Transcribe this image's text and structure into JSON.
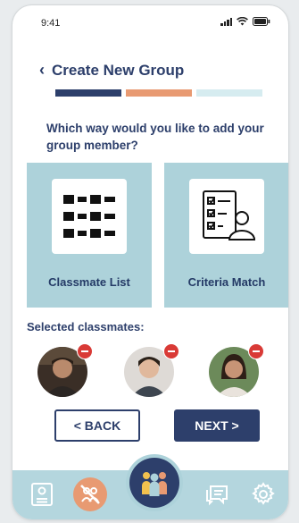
{
  "status": {
    "time": "9:41"
  },
  "header": {
    "back_icon": "chevron-left-icon",
    "title": "Create New Group"
  },
  "progress": {
    "steps": [
      "#2d3f6b",
      "#e89a72",
      "#d6ecf0"
    ]
  },
  "question": "Which way would you like to add your group member?",
  "options": [
    {
      "label": "Classmate List",
      "icon": "grid-list-icon"
    },
    {
      "label": "Criteria Match",
      "icon": "checklist-person-icon"
    }
  ],
  "selected": {
    "heading": "Selected classmates:",
    "count": 3
  },
  "buttons": {
    "back": "< BACK",
    "next": "NEXT >"
  },
  "colors": {
    "primary": "#2d3f6b",
    "card": "#add2da",
    "accent": "#e89a72",
    "remove": "#d93a36"
  },
  "nav": {
    "items": [
      "profile-icon",
      "no-people-icon",
      "group-icon",
      "chat-icon",
      "settings-icon"
    ]
  }
}
